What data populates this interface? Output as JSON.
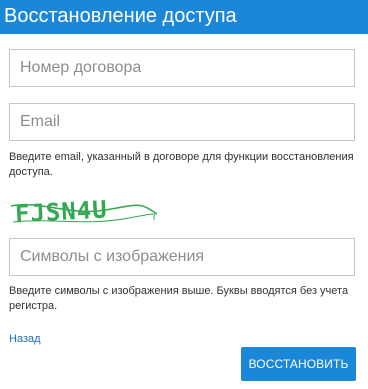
{
  "header": {
    "title": "Восстановление доступа"
  },
  "form": {
    "contract_placeholder": "Номер договора",
    "email_placeholder": "Email",
    "email_hint": "Введите email, указанный в договоре для функции восстановления доступа.",
    "captcha_text": "FJSN4U",
    "captcha_placeholder": "Символы с изображения",
    "captcha_hint": "Введите символы с изображения выше. Буквы вводятся без учета регистра."
  },
  "actions": {
    "back_label": "Назад",
    "submit_label": "ВОССТАНОВИТЬ"
  },
  "colors": {
    "accent": "#1a87d9",
    "link": "#1a6fc4",
    "captcha": "#34a853"
  }
}
